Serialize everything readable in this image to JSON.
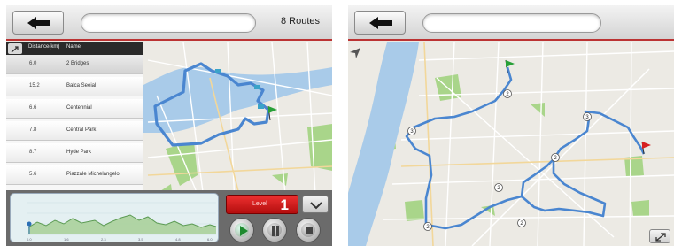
{
  "left_screen": {
    "header": {
      "back_icon": "back-arrow-icon",
      "search_placeholder": "",
      "routes_count": "8 Routes"
    },
    "route_list": {
      "columns": [
        "Distance(km)",
        "Name"
      ],
      "rows": [
        {
          "distance": "6.0",
          "name": "2 Bridges"
        },
        {
          "distance": "15.2",
          "name": "Balca Seeial"
        },
        {
          "distance": "6.6",
          "name": "Centennial"
        },
        {
          "distance": "7.8",
          "name": "Central Park"
        },
        {
          "distance": "8.7",
          "name": "Hyde Park"
        },
        {
          "distance": "5.6",
          "name": "Piazzale Michelangelo"
        }
      ],
      "selected_index": 0
    },
    "elevation_profile": {
      "x_ticks": [
        "0.0",
        "1.6",
        "2.3",
        "3.5",
        "4.8",
        "6.0"
      ]
    },
    "level": {
      "label": "Level",
      "value": "1"
    },
    "controls": [
      "play-icon",
      "pause-icon",
      "stop-icon"
    ],
    "colors": {
      "route": "#4a86d0",
      "level_red": "#d61f1f",
      "header_accent": "#b33333",
      "river": "#a9cbe9",
      "park": "#a9d58a"
    }
  },
  "right_screen": {
    "header": {
      "back_icon": "back-arrow-icon",
      "search_placeholder": ""
    },
    "waypoint_markers": [
      "2",
      "3",
      "3",
      "2",
      "2",
      "2",
      "2"
    ],
    "start_pin_color": "#28a038",
    "end_pin_color": "#d62020"
  }
}
